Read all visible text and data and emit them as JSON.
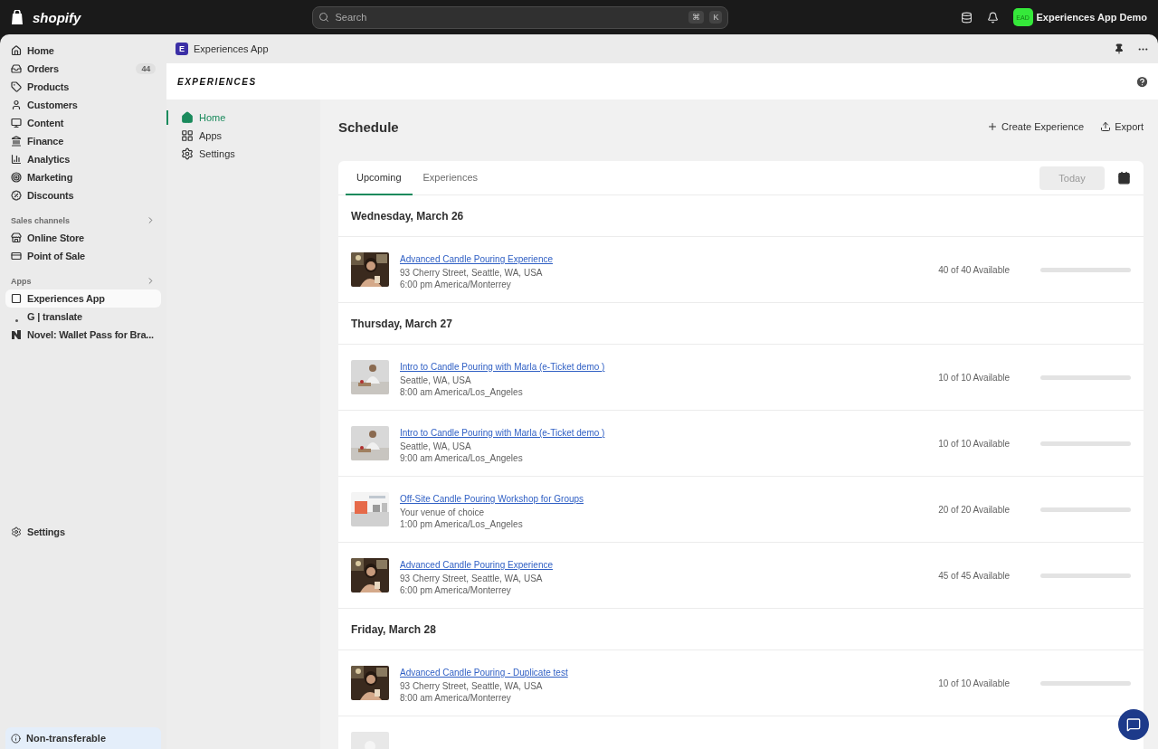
{
  "topbar": {
    "brand": "shopify",
    "search_placeholder": "Search",
    "shortcut_keys": [
      "⌘",
      "K"
    ],
    "store_initials": "EAD",
    "store_name": "Experiences App Demo"
  },
  "sidebar": {
    "items": [
      {
        "label": "Home",
        "selected": false
      },
      {
        "label": "Orders",
        "selected": false,
        "badge": "44"
      },
      {
        "label": "Products",
        "selected": false
      },
      {
        "label": "Customers",
        "selected": false
      },
      {
        "label": "Content",
        "selected": false
      },
      {
        "label": "Finance",
        "selected": false
      },
      {
        "label": "Analytics",
        "selected": false
      },
      {
        "label": "Marketing",
        "selected": false
      },
      {
        "label": "Discounts",
        "selected": false
      }
    ],
    "sections": [
      {
        "title": "Sales channels",
        "items": [
          {
            "label": "Online Store",
            "selected": false
          },
          {
            "label": "Point of Sale",
            "selected": false
          }
        ]
      },
      {
        "title": "Apps",
        "items": [
          {
            "label": "Experiences App",
            "selected": true
          },
          {
            "label": "G | translate",
            "selected": false
          },
          {
            "label": "Novel: Wallet Pass for Bra...",
            "selected": false
          }
        ]
      }
    ],
    "settings": "Settings",
    "notice": "Non-transferable"
  },
  "app": {
    "title": "Experiences App",
    "initial": "E",
    "logo": "EXPERIENCES",
    "nav": [
      {
        "label": "Home",
        "selected": true
      },
      {
        "label": "Apps",
        "selected": false
      },
      {
        "label": "Settings",
        "selected": false
      }
    ]
  },
  "schedule": {
    "title": "Schedule",
    "actions": [
      "Create Experience",
      "Export"
    ],
    "tabs": [
      {
        "label": "Upcoming",
        "selected": true
      },
      {
        "label": "Experiences",
        "selected": false
      }
    ],
    "today_button": "Today",
    "days": [
      {
        "date": "Wednesday, March 26",
        "events": [
          {
            "kind": "event",
            "title": "Advanced Candle Pouring Experience",
            "location": "93 Cherry Street, Seattle, WA, USA",
            "time": "6:00 pm America/Monterrey",
            "availability": "40 of 40 Available"
          }
        ]
      },
      {
        "date": "Thursday, March 27",
        "events": [
          {
            "kind": "event",
            "title": "Intro to Candle Pouring with Marla (e-Ticket demo )",
            "location": "Seattle, WA, USA",
            "time": "8:00 am America/Los_Angeles",
            "availability": "10 of 10 Available"
          },
          {
            "kind": "event",
            "title": "Intro to Candle Pouring with Marla (e-Ticket demo )",
            "location": "Seattle, WA, USA",
            "time": "9:00 am America/Los_Angeles",
            "availability": "10 of 10 Available"
          },
          {
            "kind": "event",
            "title": "Off-Site Candle Pouring Workshop for Groups",
            "location": "Your venue of choice",
            "time": "1:00 pm America/Los_Angeles",
            "availability": "20 of 20 Available"
          },
          {
            "kind": "event",
            "title": "Advanced Candle Pouring Experience",
            "location": "93 Cherry Street, Seattle, WA, USA",
            "time": "6:00 pm America/Monterrey",
            "availability": "45 of 45 Available"
          }
        ]
      },
      {
        "date": "Friday, March 28",
        "events": [
          {
            "kind": "event",
            "title": "Advanced Candle Pouring - Duplicate test",
            "location": "93 Cherry Street, Seattle, WA, USA",
            "time": "8:00 am America/Monterrey",
            "availability": "10 of 10 Available"
          },
          {
            "kind": "picture"
          }
        ]
      }
    ]
  }
}
